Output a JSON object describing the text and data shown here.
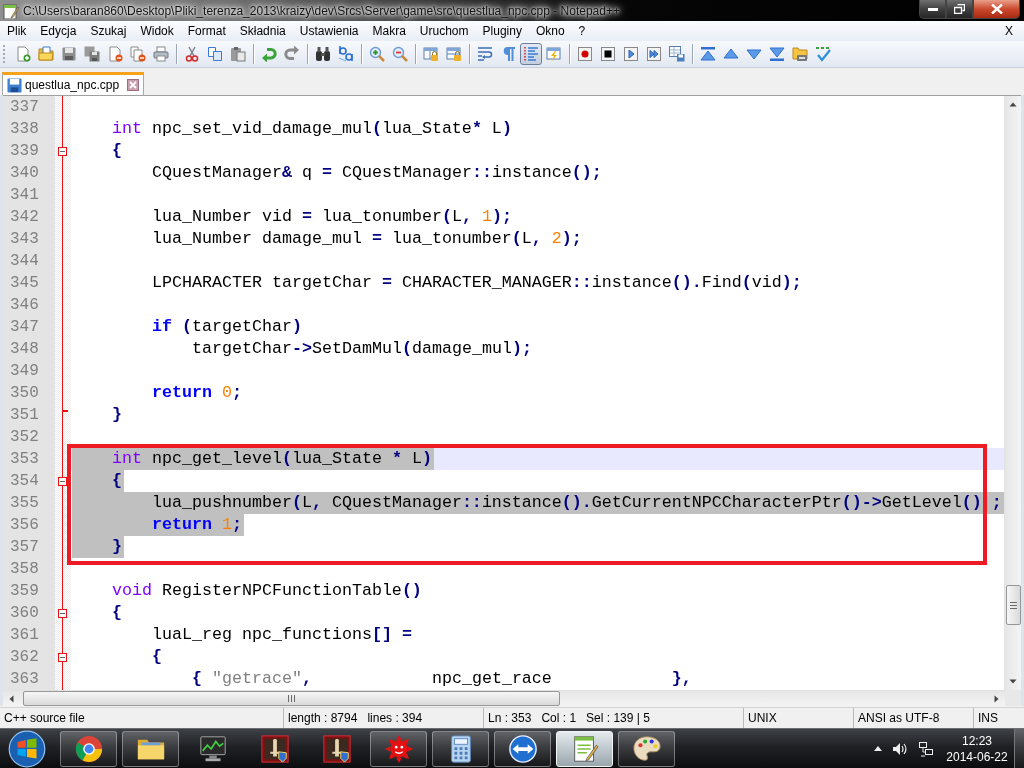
{
  "window": {
    "title": "C:\\Users\\baran860\\Desktop\\Pliki_terenza_2013\\kraizy\\dev\\Srcs\\Server\\game\\src\\questlua_npc.cpp - Notepad++"
  },
  "menu": {
    "items": [
      "Plik",
      "Edycja",
      "Szukaj",
      "Widok",
      "Format",
      "Składnia",
      "Ustawienia",
      "Makra",
      "Uruchom",
      "Pluginy",
      "Okno",
      "?"
    ],
    "close_label": "X"
  },
  "toolbar": {
    "groups": [
      [
        {
          "kind": "new",
          "pressed": false
        },
        {
          "kind": "open",
          "pressed": false
        },
        {
          "kind": "save",
          "pressed": false
        },
        {
          "kind": "saveall",
          "pressed": false
        },
        {
          "kind": "close",
          "pressed": false
        },
        {
          "kind": "closeall",
          "pressed": false
        },
        {
          "kind": "print",
          "pressed": false
        }
      ],
      [
        {
          "kind": "cut",
          "pressed": false
        },
        {
          "kind": "copy",
          "pressed": false
        },
        {
          "kind": "paste",
          "pressed": false
        }
      ],
      [
        {
          "kind": "undo",
          "pressed": false
        },
        {
          "kind": "redo",
          "pressed": false
        }
      ],
      [
        {
          "kind": "find",
          "pressed": false
        },
        {
          "kind": "replace",
          "pressed": false
        }
      ],
      [
        {
          "kind": "zoomin",
          "pressed": false
        },
        {
          "kind": "zoomout",
          "pressed": false
        }
      ],
      [
        {
          "kind": "syncv",
          "pressed": false
        },
        {
          "kind": "synch",
          "pressed": false
        }
      ],
      [
        {
          "kind": "wrap",
          "pressed": false
        },
        {
          "kind": "allchars",
          "pressed": false
        },
        {
          "kind": "indentguide",
          "pressed": true
        },
        {
          "kind": "userlang",
          "pressed": false
        }
      ],
      [
        {
          "kind": "record",
          "pressed": false
        },
        {
          "kind": "stop",
          "pressed": false
        },
        {
          "kind": "play",
          "pressed": false
        },
        {
          "kind": "playmulti",
          "pressed": false
        },
        {
          "kind": "savemacro",
          "pressed": false
        }
      ],
      [
        {
          "kind": "top",
          "pressed": false
        },
        {
          "kind": "up",
          "pressed": false
        },
        {
          "kind": "down",
          "pressed": false
        },
        {
          "kind": "bottom",
          "pressed": false
        },
        {
          "kind": "foldertape",
          "pressed": false
        },
        {
          "kind": "spellcheck",
          "pressed": false
        }
      ]
    ]
  },
  "tabs": [
    {
      "label": "questlua_npc.cpp",
      "selected": true
    }
  ],
  "editor": {
    "lines": [
      {
        "number": "337",
        "kind": "blank",
        "selected": false,
        "current": false
      },
      {
        "number": "338",
        "kind": "code",
        "tokens": [
          {
            "kind": "type",
            "text": "int"
          },
          {
            "kind": "plain",
            "text": " npc_set_vid_damage_mul"
          },
          {
            "kind": "operator",
            "text": "("
          },
          {
            "kind": "plain",
            "text": "lua_State"
          },
          {
            "kind": "operator",
            "text": "*"
          },
          {
            "kind": "plain",
            "text": " L"
          },
          {
            "kind": "operator",
            "text": ")"
          }
        ],
        "selected": false,
        "current": false
      },
      {
        "number": "339",
        "kind": "foldstart",
        "tokens": [
          {
            "kind": "operator",
            "text": "{"
          }
        ],
        "selected": false,
        "current": false,
        "children": [
          {
            "number": "340",
            "kind": "code",
            "tokens": [
              {
                "kind": "plain",
                "text": "CQuestManager"
              },
              {
                "kind": "operator",
                "text": "&"
              },
              {
                "kind": "plain",
                "text": " q "
              },
              {
                "kind": "operator",
                "text": "="
              },
              {
                "kind": "plain",
                "text": " CQuestManager"
              },
              {
                "kind": "operator",
                "text": "::"
              },
              {
                "kind": "plain",
                "text": "instance"
              },
              {
                "kind": "operator",
                "text": "();"
              }
            ],
            "selected": false,
            "current": false
          },
          {
            "number": "341",
            "kind": "blank",
            "selected": false,
            "current": false
          },
          {
            "number": "342",
            "kind": "code",
            "tokens": [
              {
                "kind": "plain",
                "text": "lua_Number vid "
              },
              {
                "kind": "operator",
                "text": "="
              },
              {
                "kind": "plain",
                "text": " lua_tonumber"
              },
              {
                "kind": "operator",
                "text": "("
              },
              {
                "kind": "plain",
                "text": "L"
              },
              {
                "kind": "operator",
                "text": ","
              },
              {
                "kind": "number",
                "text": " 1"
              },
              {
                "kind": "operator",
                "text": ");"
              }
            ],
            "selected": false,
            "current": false
          },
          {
            "number": "343",
            "kind": "code",
            "tokens": [
              {
                "kind": "plain",
                "text": "lua_Number damage_mul "
              },
              {
                "kind": "operator",
                "text": "="
              },
              {
                "kind": "plain",
                "text": " lua_tonumber"
              },
              {
                "kind": "operator",
                "text": "("
              },
              {
                "kind": "plain",
                "text": "L"
              },
              {
                "kind": "operator",
                "text": ","
              },
              {
                "kind": "number",
                "text": " 2"
              },
              {
                "kind": "operator",
                "text": ");"
              }
            ],
            "selected": false,
            "current": false
          },
          {
            "number": "344",
            "kind": "blank",
            "selected": false,
            "current": false
          },
          {
            "number": "345",
            "kind": "code",
            "tokens": [
              {
                "kind": "plain",
                "text": "LPCHARACTER targetChar "
              },
              {
                "kind": "operator",
                "text": "="
              },
              {
                "kind": "plain",
                "text": " CHARACTER_MANAGER"
              },
              {
                "kind": "operator",
                "text": "::"
              },
              {
                "kind": "plain",
                "text": "instance"
              },
              {
                "kind": "operator",
                "text": "()."
              },
              {
                "kind": "plain",
                "text": "Find"
              },
              {
                "kind": "operator",
                "text": "("
              },
              {
                "kind": "plain",
                "text": "vid"
              },
              {
                "kind": "operator",
                "text": ");"
              }
            ],
            "selected": false,
            "current": false
          },
          {
            "number": "346",
            "kind": "blank",
            "selected": false,
            "current": false
          },
          {
            "number": "347",
            "kind": "code",
            "tokens": [
              {
                "kind": "keyword",
                "text": "if"
              },
              {
                "kind": "operator",
                "text": " ("
              },
              {
                "kind": "plain",
                "text": "targetChar"
              },
              {
                "kind": "operator",
                "text": ")"
              }
            ],
            "selected": false,
            "current": false,
            "children": [
              {
                "number": "348",
                "kind": "code",
                "tokens": [
                  {
                    "kind": "plain",
                    "text": "targetChar"
                  },
                  {
                    "kind": "operator",
                    "text": "->"
                  },
                  {
                    "kind": "plain",
                    "text": "SetDamMul"
                  },
                  {
                    "kind": "operator",
                    "text": "("
                  },
                  {
                    "kind": "plain",
                    "text": "damage_mul"
                  },
                  {
                    "kind": "operator",
                    "text": ");"
                  }
                ],
                "selected": false,
                "current": false
              }
            ]
          },
          {
            "number": "349",
            "kind": "blank",
            "selected": false,
            "current": false
          },
          {
            "number": "350",
            "kind": "code",
            "tokens": [
              {
                "kind": "keyword",
                "text": "return"
              },
              {
                "kind": "number",
                "text": " 0"
              },
              {
                "kind": "operator",
                "text": ";"
              }
            ],
            "selected": false,
            "current": false
          }
        ]
      },
      {
        "number": "351",
        "kind": "foldend",
        "tokens": [
          {
            "kind": "operator",
            "text": "}"
          }
        ],
        "selected": false,
        "current": false
      },
      {
        "number": "352",
        "kind": "blank",
        "selected": false,
        "current": false
      },
      {
        "kind": "annotation",
        "children": [
          {
            "number": "353",
            "kind": "code",
            "tokens": [
              {
                "kind": "type",
                "text": "int"
              },
              {
                "kind": "plain",
                "text": " npc_get_level"
              },
              {
                "kind": "operator",
                "text": "("
              },
              {
                "kind": "plain",
                "text": "lua_State "
              },
              {
                "kind": "operator",
                "text": "*"
              },
              {
                "kind": "plain",
                "text": " L"
              },
              {
                "kind": "operator",
                "text": ")"
              }
            ],
            "selected": true,
            "current": true
          },
          {
            "number": "354",
            "kind": "foldstart",
            "tokens": [
              {
                "kind": "operator",
                "text": "{"
              }
            ],
            "selected": true,
            "current": false,
            "children": [
              {
                "number": "355",
                "kind": "code",
                "tokens": [
                  {
                    "kind": "plain",
                    "text": "lua_pushnumber"
                  },
                  {
                    "kind": "operator",
                    "text": "("
                  },
                  {
                    "kind": "plain",
                    "text": "L"
                  },
                  {
                    "kind": "operator",
                    "text": ","
                  },
                  {
                    "kind": "plain",
                    "text": " CQuestManager"
                  },
                  {
                    "kind": "operator",
                    "text": "::"
                  },
                  {
                    "kind": "plain",
                    "text": "instance"
                  },
                  {
                    "kind": "operator",
                    "text": "()."
                  },
                  {
                    "kind": "plain",
                    "text": "GetCurrentNPCCharacterPtr"
                  },
                  {
                    "kind": "operator",
                    "text": "()->"
                  },
                  {
                    "kind": "plain",
                    "text": "GetLevel"
                  },
                  {
                    "kind": "operator",
                    "text": "() ;"
                  }
                ],
                "selected": true,
                "current": false
              },
              {
                "number": "356",
                "kind": "code",
                "tokens": [
                  {
                    "kind": "keyword",
                    "text": "return"
                  },
                  {
                    "kind": "number",
                    "text": " 1"
                  },
                  {
                    "kind": "operator",
                    "text": ";"
                  }
                ],
                "selected": true,
                "current": false
              }
            ]
          },
          {
            "number": "357",
            "kind": "code",
            "tokens": [
              {
                "kind": "operator",
                "text": "}"
              }
            ],
            "selected": true,
            "current": false
          }
        ]
      },
      {
        "number": "358",
        "kind": "blank",
        "selected": false,
        "current": false
      },
      {
        "number": "359",
        "kind": "code",
        "tokens": [
          {
            "kind": "type",
            "text": "void"
          },
          {
            "kind": "plain",
            "text": " RegisterNPCFunctionTable"
          },
          {
            "kind": "operator",
            "text": "()"
          }
        ],
        "selected": false,
        "current": false
      },
      {
        "number": "360",
        "kind": "foldstart",
        "tokens": [
          {
            "kind": "operator",
            "text": "{"
          }
        ],
        "selected": false,
        "current": false,
        "children": [
          {
            "number": "361",
            "kind": "code",
            "tokens": [
              {
                "kind": "plain",
                "text": "luaL_reg npc_functions"
              },
              {
                "kind": "operator",
                "text": "[] ="
              }
            ],
            "selected": false,
            "current": false
          },
          {
            "number": "362",
            "kind": "foldstart",
            "tokens": [
              {
                "kind": "operator",
                "text": "{"
              }
            ],
            "selected": false,
            "current": false,
            "children": [
              {
                "number": "363",
                "kind": "code",
                "tokens": [
                  {
                    "kind": "operator",
                    "text": "{ "
                  },
                  {
                    "kind": "string",
                    "text": "\"getrace\""
                  },
                  {
                    "kind": "operator",
                    "text": ","
                  },
                  {
                    "kind": "plain",
                    "text": "            npc_get_race            "
                  },
                  {
                    "kind": "operator",
                    "text": "},"
                  }
                ],
                "selected": false,
                "current": false
              }
            ]
          }
        ]
      }
    ]
  },
  "status_bar": {
    "panels": [
      {
        "texts": [
          "C++ source file"
        ]
      },
      {
        "texts": [
          "length : 8794",
          "lines : 394"
        ]
      },
      {
        "texts": [
          "Ln : 353",
          "Col : 1",
          "Sel : 139 | 5"
        ]
      },
      {
        "texts": [
          "UNIX"
        ]
      },
      {
        "texts": [
          "ANSI as UTF-8"
        ]
      },
      {
        "texts": [
          "INS"
        ]
      }
    ]
  },
  "taskbar": {
    "apps": [
      {
        "kind": "browser",
        "running": true,
        "selected": false
      },
      {
        "kind": "explorer",
        "running": true,
        "selected": false
      },
      {
        "kind": "monitor",
        "running": false,
        "selected": false
      },
      {
        "kind": "game",
        "running": false,
        "selected": false
      },
      {
        "kind": "game",
        "running": false,
        "selected": false
      },
      {
        "kind": "sun",
        "running": true,
        "selected": false
      },
      {
        "kind": "calculator",
        "running": true,
        "selected": false
      },
      {
        "kind": "remote",
        "running": true,
        "selected": false
      },
      {
        "kind": "notepad",
        "running": true,
        "selected": true
      },
      {
        "kind": "paint",
        "running": true,
        "selected": false
      }
    ],
    "clock": {
      "time": "12:23",
      "date": "2014-06-22"
    }
  }
}
